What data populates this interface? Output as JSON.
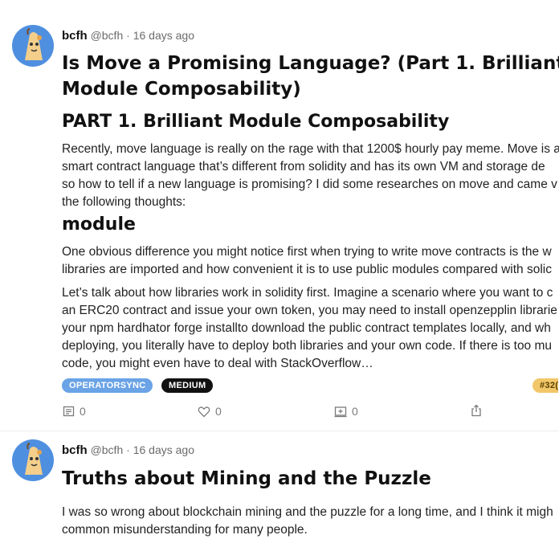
{
  "posts": [
    {
      "author": "bcfh",
      "handle": "@bcfh",
      "time": "· 16 days ago",
      "title_lines": [
        "Is Move a Promising Language? (Part 1. Brilliant",
        "Module Composability)"
      ],
      "heading": "PART 1. Brilliant Module Composability",
      "paragraph1": [
        "Recently, move language is really on the rage with that 1200$ hourly pay meme. Move is a",
        "smart contract language that’s different from solidity and has its own VM and storage de",
        "so how to tell if a new language is promising? I did some researches on move and came v",
        "the following thoughts:"
      ],
      "subheading": "module",
      "paragraph2": [
        "One obvious difference you might notice first when trying to write move contracts is the w",
        "libraries are imported and how convenient it is to use public modules compared with solic"
      ],
      "paragraph3": [
        "Let’s talk about how libraries work in solidity first. Imagine a scenario where you want to c",
        "an ERC20 contract and issue your own token, you may need to install openzepplin librarie",
        "your npm hardhator forge installto download the public contract templates locally, and wh",
        "deploying, you literally have to deploy both libraries and your own code. If there is too mu",
        "code, you might even have to deal with StackOverflow…"
      ],
      "tags": [
        "OPERATORSYNC",
        "MEDIUM"
      ],
      "number_tag": "#32(",
      "actions": {
        "comments": "0",
        "likes": "0",
        "collects": "0"
      }
    },
    {
      "author": "bcfh",
      "handle": "@bcfh",
      "time": "· 16 days ago",
      "title": "Truths about Mining and the Puzzle",
      "paragraph1": [
        "I was so wrong about blockchain mining and the puzzle for a long time, and I think it migh",
        "common misunderstanding for many people."
      ]
    }
  ],
  "colors": {
    "accent_blue": "#6aa3e6",
    "tag_dark": "#111111",
    "tag_gold": "#f2c76a",
    "avatar_bg": "#4f8fe0"
  }
}
